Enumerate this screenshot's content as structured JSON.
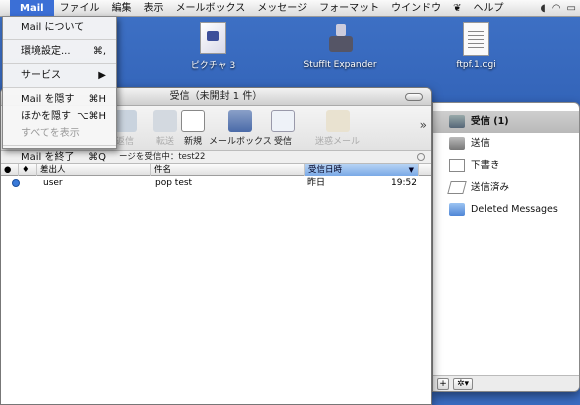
{
  "menubar": {
    "app": "Mail",
    "items": [
      "ファイル",
      "編集",
      "表示",
      "メールボックス",
      "メッセージ",
      "フォーマット",
      "ウインドウ",
      "ヘルプ"
    ]
  },
  "app_menu": {
    "items": [
      {
        "label": "Mail について",
        "shortcut": ""
      },
      {
        "label": "環境設定...",
        "shortcut": "⌘,"
      },
      {
        "label": "サービス",
        "shortcut": "▶"
      },
      {
        "label": "Mail を隠す",
        "shortcut": "⌘H"
      },
      {
        "label": "ほかを隠す",
        "shortcut": "⌥⌘H"
      },
      {
        "label": "すべてを表示",
        "shortcut": ""
      },
      {
        "label": "Mail を終了",
        "shortcut": "⌘Q"
      }
    ]
  },
  "desktop": {
    "icons": [
      {
        "label": "ピクチャ 3"
      },
      {
        "label": "StuffIt Expander"
      },
      {
        "label": "ftpf.1.cgi"
      }
    ]
  },
  "window": {
    "title": "受信（未開封 1 件）",
    "toolbar": {
      "partial": "返信",
      "forward": "転送",
      "new": "新規",
      "mailboxes": "メールボックス",
      "receive": "受信",
      "junk": "迷惑メール"
    },
    "status": "ージを受信中：test22",
    "columns": {
      "from": "差出人",
      "subject": "件名",
      "date": "受信日時"
    },
    "messages": [
      {
        "from": "user",
        "subject": "pop test",
        "date": "昨日",
        "time": "19:52"
      }
    ]
  },
  "drawer": {
    "mailboxes": [
      {
        "label": "受信 (1)"
      },
      {
        "label": "送信"
      },
      {
        "label": "下書き"
      },
      {
        "label": "送信済み"
      },
      {
        "label": "Deleted Messages"
      }
    ],
    "add_label": "+",
    "action_label": "✲▾"
  },
  "colors": {
    "selection": "#3b6fd6",
    "desktop": "#3f72c6"
  }
}
